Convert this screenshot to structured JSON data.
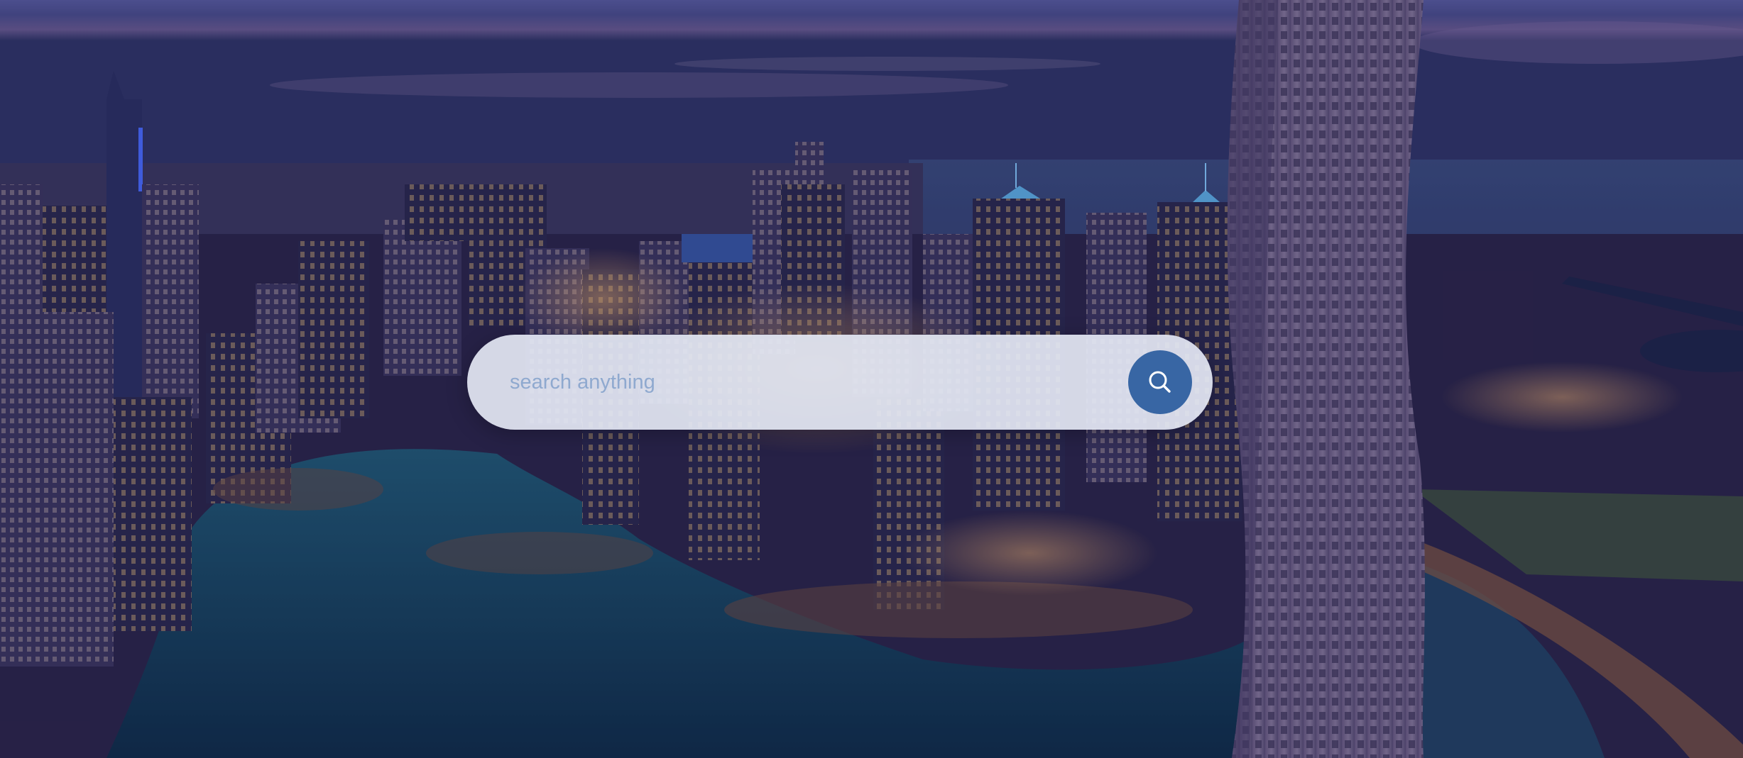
{
  "background": {
    "description_icon": "city-skyline-image",
    "overlay_color": "#1c1e5a"
  },
  "search": {
    "placeholder": "search anything",
    "value": "",
    "button_icon": "search-icon",
    "button_color": "#3866a4"
  }
}
